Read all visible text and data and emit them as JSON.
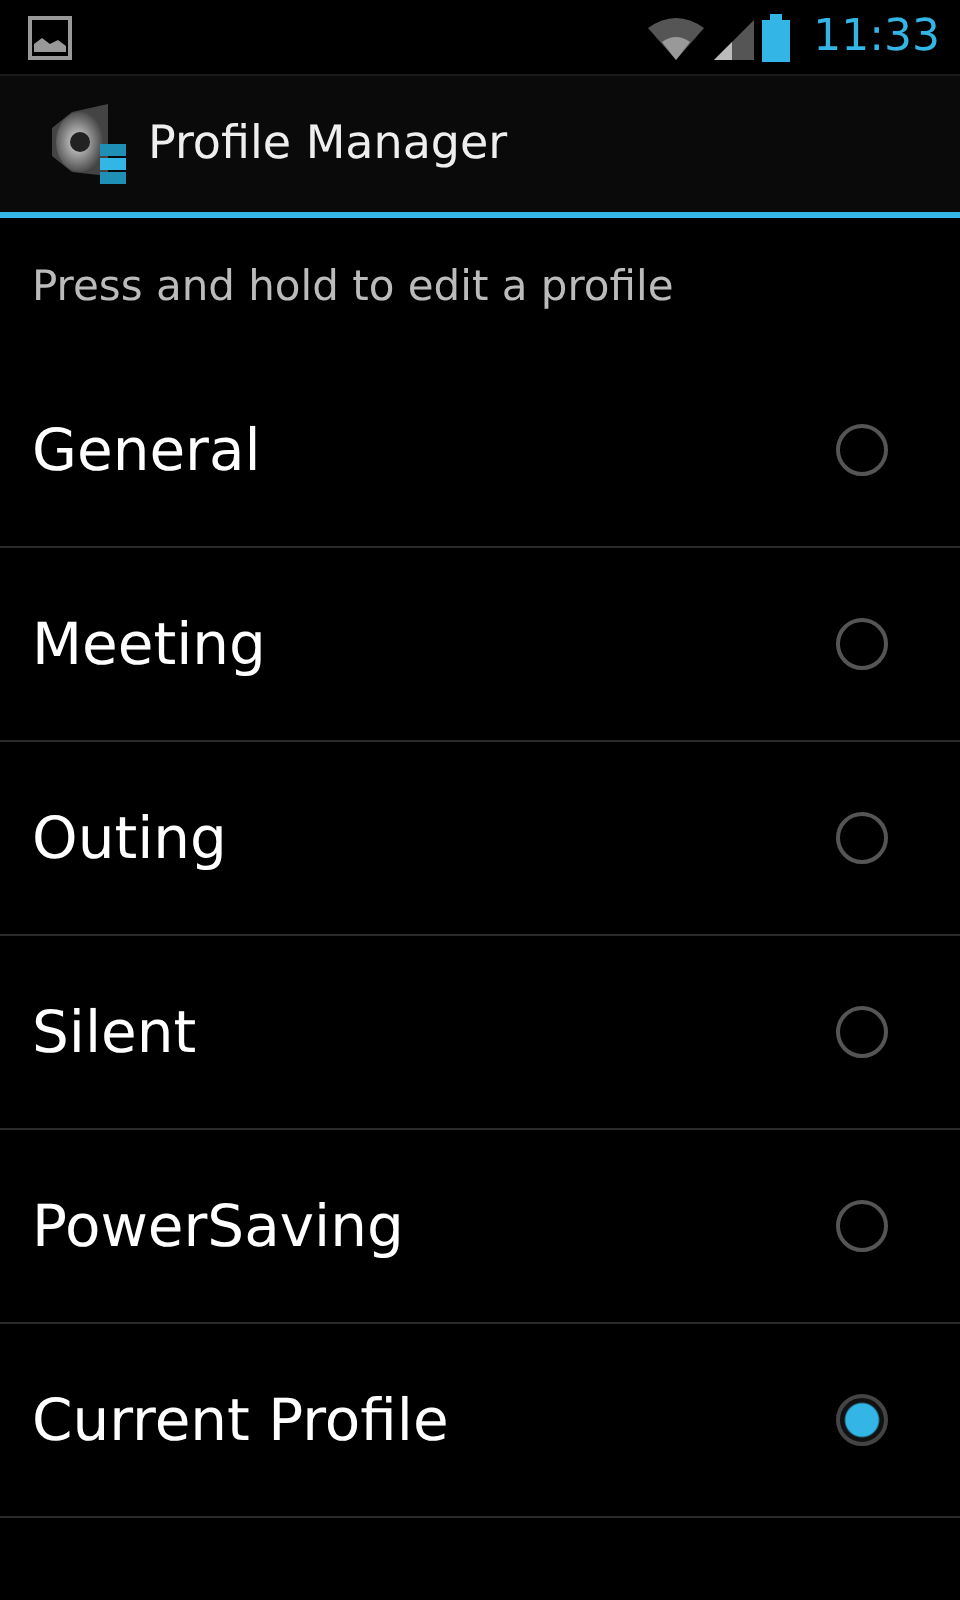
{
  "status_bar": {
    "time": "11:33"
  },
  "action_bar": {
    "title": "Profile Manager"
  },
  "hint": "Press and hold to edit a profile",
  "profiles": [
    {
      "label": "General",
      "selected": false
    },
    {
      "label": "Meeting",
      "selected": false
    },
    {
      "label": "Outing",
      "selected": false
    },
    {
      "label": "Silent",
      "selected": false
    },
    {
      "label": "PowerSaving",
      "selected": false
    },
    {
      "label": "Current Profile",
      "selected": true
    }
  ]
}
